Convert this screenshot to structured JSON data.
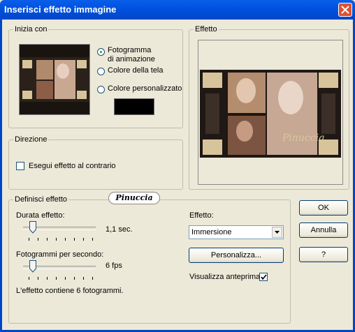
{
  "window": {
    "title": "Inserisci effetto immagine"
  },
  "start_group": {
    "legend": "Inizia con",
    "options": [
      "Fotogramma di animazione",
      "Colore della tela",
      "Colore personalizzato"
    ],
    "option_line1": "Fotogramma",
    "option_line2": "di animazione",
    "selected": "Fotogramma di animazione",
    "custom_color": "#000000"
  },
  "effect_preview": {
    "legend": "Effetto",
    "watermark": "Pinuccia"
  },
  "direction_group": {
    "legend": "Direzione",
    "reverse_label": "Esegui effetto al contrario",
    "reverse_checked": false
  },
  "define_group": {
    "legend": "Definisci effetto",
    "badge": "Pinuccia",
    "duration_label": "Durata effetto:",
    "duration_value": "1,1 sec.",
    "duration_level": 0.1,
    "fps_label": "Fotogrammi per secondo:",
    "fps_value": "6 fps",
    "fps_level": 0.1,
    "effect_label": "Effetto:",
    "effect_selected": "Immersione",
    "customize_label": "Personalizza...",
    "preview_label": "Visualizza anteprima",
    "preview_checked": true,
    "frames_info": "L'effetto contiene 6 fotogrammi."
  },
  "buttons": {
    "ok": "OK",
    "cancel": "Annulla",
    "help": "?"
  },
  "colors": {
    "titlebar": "#0053e0",
    "dialog_bg": "#ece9d8",
    "close": "#e0512e"
  }
}
